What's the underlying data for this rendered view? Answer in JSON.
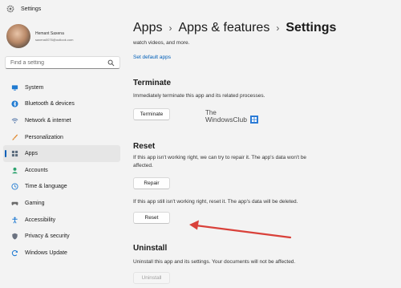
{
  "window": {
    "title": "Settings",
    "icon": "settings-app-icon"
  },
  "profile": {
    "name": "Hemant Saxena",
    "email": "saxena0076@outlook.com"
  },
  "search": {
    "placeholder": "Find a setting",
    "icon": "search-icon"
  },
  "sidebar": {
    "active_index": 3,
    "items": [
      {
        "label": "System",
        "icon": "monitor-icon",
        "color": "#1f7ad1"
      },
      {
        "label": "Bluetooth & devices",
        "icon": "bluetooth-icon",
        "color": "#1f7ad1"
      },
      {
        "label": "Network & internet",
        "icon": "wifi-icon",
        "color": "#4a6fa5"
      },
      {
        "label": "Personalization",
        "icon": "brush-icon",
        "color": "#e0892f"
      },
      {
        "label": "Apps",
        "icon": "apps-icon",
        "color": "#5a6b7d"
      },
      {
        "label": "Accounts",
        "icon": "person-icon",
        "color": "#2ea36f"
      },
      {
        "label": "Time & language",
        "icon": "globe-clock-icon",
        "color": "#1f7ad1"
      },
      {
        "label": "Gaming",
        "icon": "controller-icon",
        "color": "#6b6b6b"
      },
      {
        "label": "Accessibility",
        "icon": "accessibility-icon",
        "color": "#1f7ad1"
      },
      {
        "label": "Privacy & security",
        "icon": "shield-icon",
        "color": "#6b7280"
      },
      {
        "label": "Windows Update",
        "icon": "update-icon",
        "color": "#1f7ad1"
      }
    ]
  },
  "breadcrumb": {
    "items": [
      "Apps",
      "Apps & features",
      "Settings"
    ],
    "separator": "›"
  },
  "content": {
    "partial_text": "watch videos, and more.",
    "default_apps_link": "Set default apps",
    "terminate": {
      "title": "Terminate",
      "description": "Immediately terminate this app and its related processes.",
      "button": "Terminate"
    },
    "reset": {
      "title": "Reset",
      "repair_description": "If this app isn't working right, we can try to repair it. The app's data won't be affected.",
      "repair_button": "Repair",
      "reset_description": "If this app still isn't working right, reset it. The app's data will be deleted.",
      "reset_button": "Reset"
    },
    "uninstall": {
      "title": "Uninstall",
      "description": "Uninstall this app and its settings. Your documents will not be affected.",
      "button": "Uninstall"
    }
  },
  "watermark": {
    "line1": "The",
    "line2": "WindowsClub"
  },
  "colors": {
    "accent": "#005fb8",
    "annotation_arrow": "#d9413a",
    "background": "#f3f3f3"
  }
}
